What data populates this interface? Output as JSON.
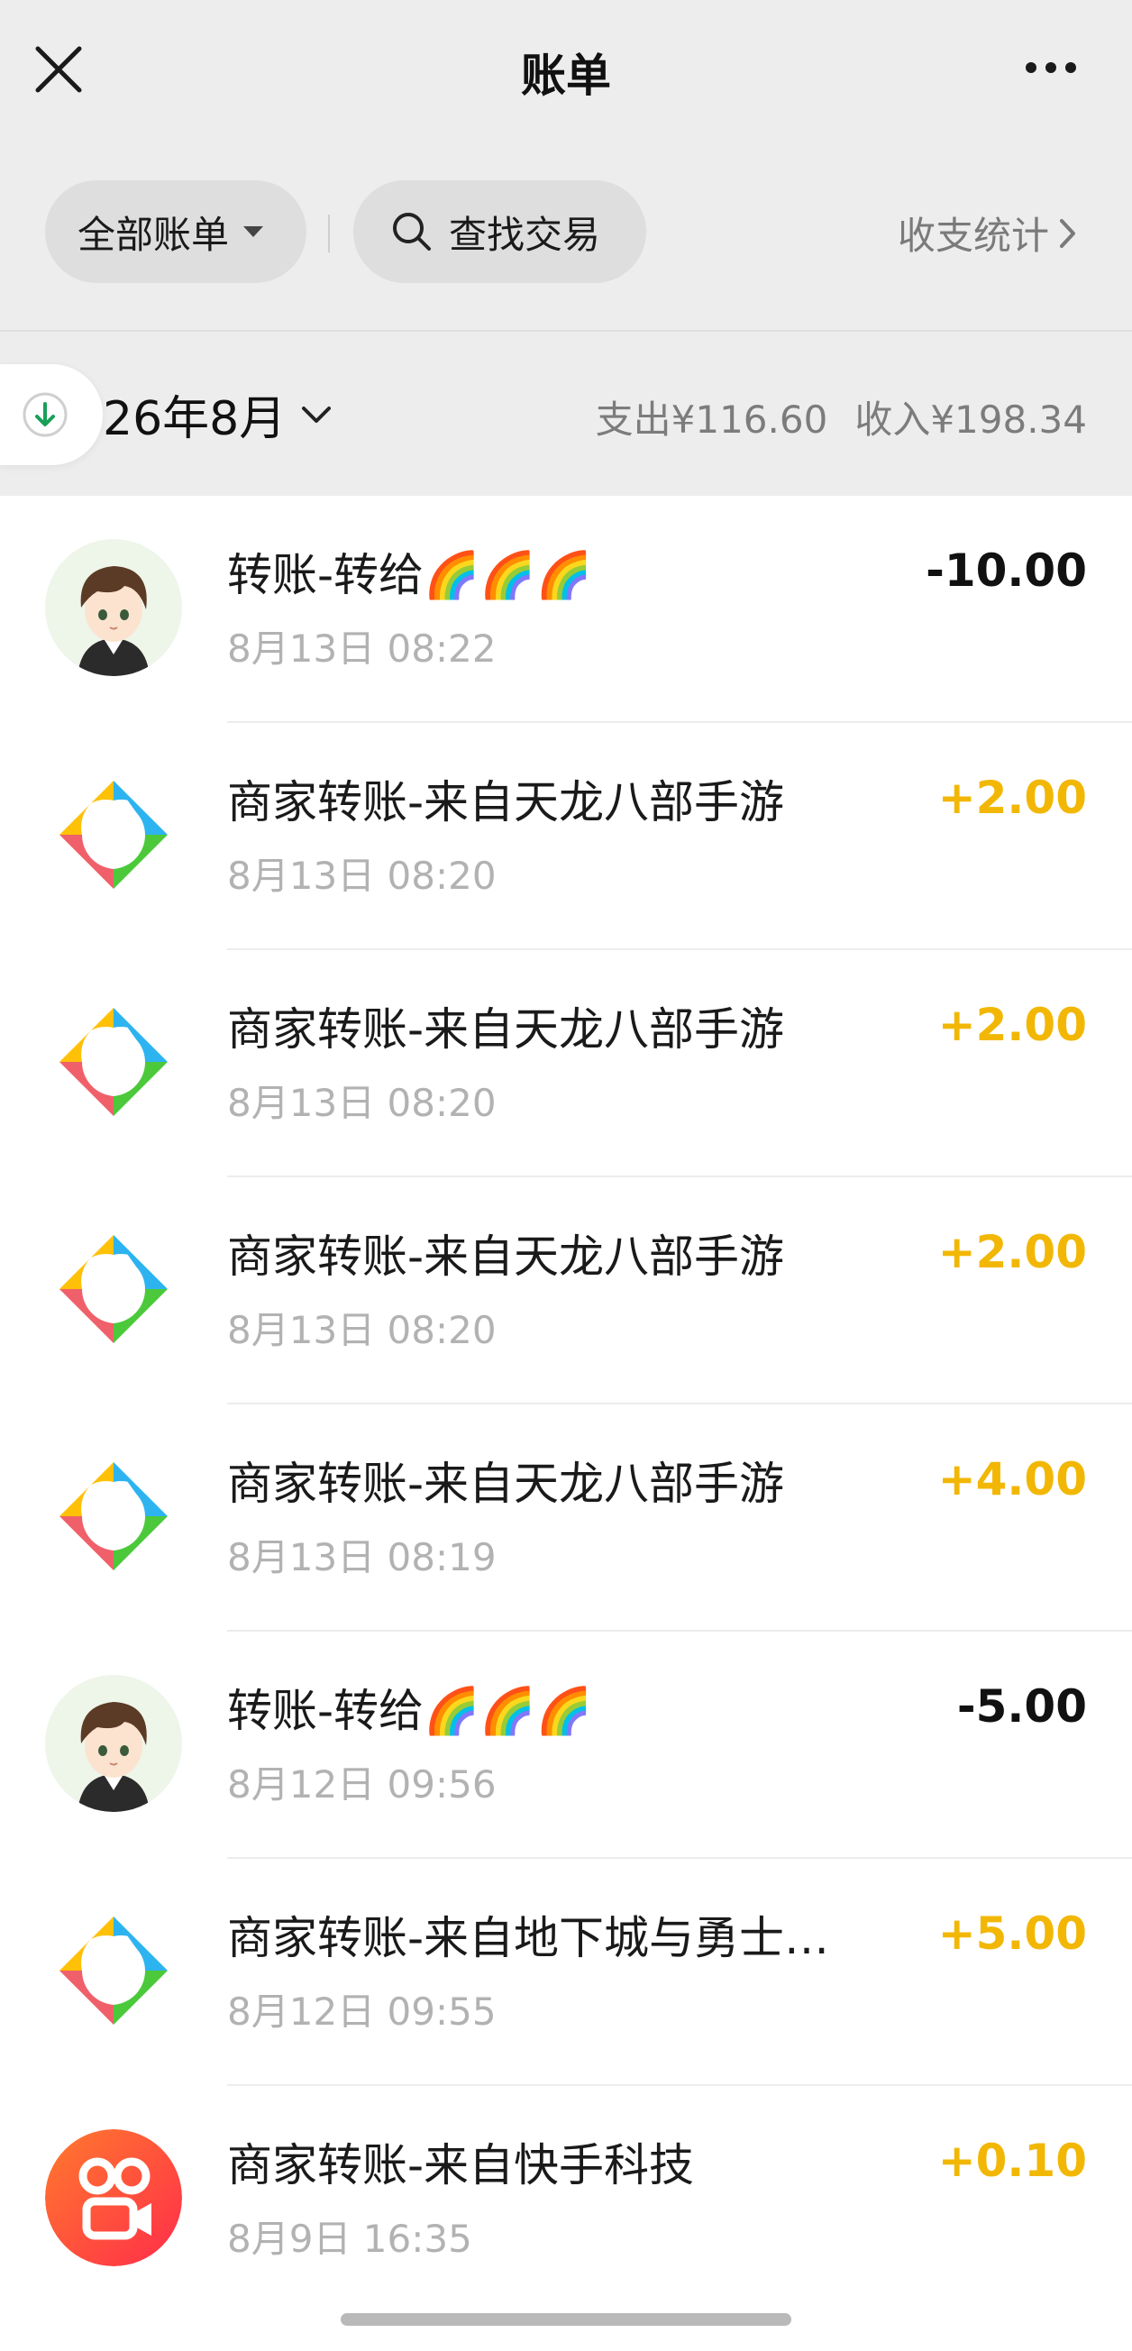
{
  "header": {
    "title": "账单"
  },
  "filters": {
    "all_bills_label": "全部账单",
    "search_label": "查找交易",
    "stats_label": "收支统计"
  },
  "month": {
    "label": "26年8月",
    "expense": "支出¥116.60",
    "income": "收入¥198.34"
  },
  "colors": {
    "income_amount": "#f2b705",
    "expense_amount": "#111111",
    "page_background": "#ededed"
  },
  "transactions": [
    {
      "title": "转账-转给🌈🌈🌈",
      "time": "8月13日 08:22",
      "amount": "-10.00",
      "type": "expense",
      "icon": "user-avatar"
    },
    {
      "title": "商家转账-来自天龙八部手游",
      "time": "8月13日 08:20",
      "amount": "+2.00",
      "type": "income",
      "icon": "merchant-logo"
    },
    {
      "title": "商家转账-来自天龙八部手游",
      "time": "8月13日 08:20",
      "amount": "+2.00",
      "type": "income",
      "icon": "merchant-logo"
    },
    {
      "title": "商家转账-来自天龙八部手游",
      "time": "8月13日 08:20",
      "amount": "+2.00",
      "type": "income",
      "icon": "merchant-logo"
    },
    {
      "title": "商家转账-来自天龙八部手游",
      "time": "8月13日 08:19",
      "amount": "+4.00",
      "type": "income",
      "icon": "merchant-logo"
    },
    {
      "title": "转账-转给🌈🌈🌈",
      "time": "8月12日 09:56",
      "amount": "-5.00",
      "type": "expense",
      "icon": "user-avatar"
    },
    {
      "title": "商家转账-来自地下城与勇士…",
      "time": "8月12日 09:55",
      "amount": "+5.00",
      "type": "income",
      "icon": "merchant-logo"
    },
    {
      "title": "商家转账-来自快手科技",
      "time": "8月9日 16:35",
      "amount": "+0.10",
      "type": "income",
      "icon": "kuaishou-logo"
    }
  ]
}
